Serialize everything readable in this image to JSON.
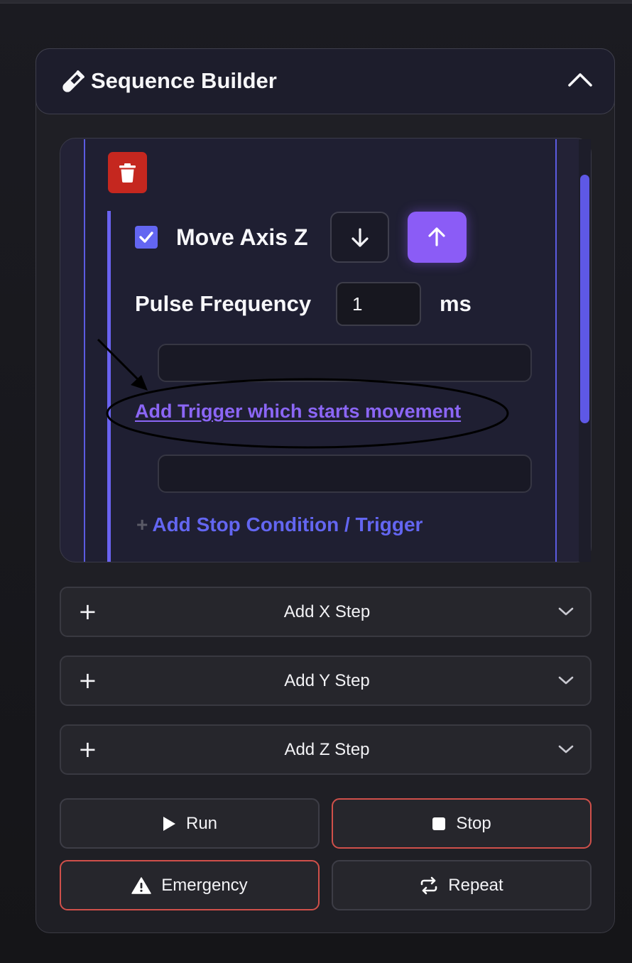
{
  "header": {
    "title": "Sequence Builder",
    "collapse_icon": "chevron-up-icon",
    "title_icon": "test-tube-icon"
  },
  "step": {
    "delete_icon": "trash-icon",
    "enabled": true,
    "title": "Move Axis Z",
    "direction_down_icon": "arrow-down-icon",
    "direction_up_icon": "arrow-up-icon",
    "active_direction": "up",
    "pulse_label": "Pulse Frequency",
    "pulse_value": "1",
    "pulse_unit": "ms",
    "start_trigger_value": "",
    "add_start_trigger_label": "Add Trigger which starts movement",
    "stop_trigger_value": "",
    "add_stop_plus": "+",
    "add_stop_label": "Add Stop Condition / Trigger"
  },
  "add_steps": [
    {
      "label": "Add X Step",
      "icon": "plus-icon",
      "chevron": "chevron-down-icon"
    },
    {
      "label": "Add Y Step",
      "icon": "plus-icon",
      "chevron": "chevron-down-icon"
    },
    {
      "label": "Add Z Step",
      "icon": "plus-icon",
      "chevron": "chevron-down-icon"
    }
  ],
  "actions": {
    "run": {
      "label": "Run",
      "icon": "play-icon"
    },
    "stop": {
      "label": "Stop",
      "icon": "stop-icon"
    },
    "emergency": {
      "label": "Emergency",
      "icon": "warning-icon"
    },
    "repeat": {
      "label": "Repeat",
      "icon": "repeat-icon"
    }
  },
  "colors": {
    "accent": "#6366f1",
    "accent_purple": "#8b5cf6",
    "danger": "#c5271f",
    "danger_border": "#d0504a"
  }
}
